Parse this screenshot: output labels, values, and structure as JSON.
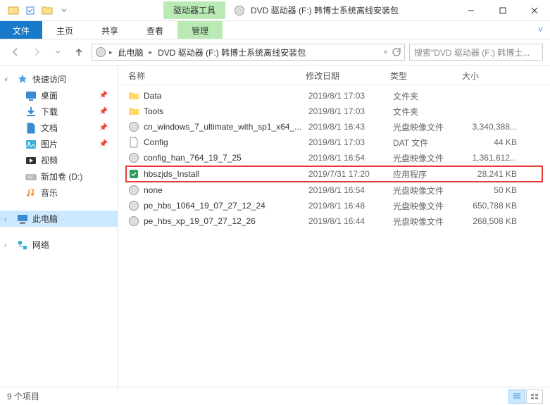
{
  "title_bar": {
    "tool_tab": "驱动器工具",
    "window_title": "DVD 驱动器 (F:) 韩博士系统离线安装包"
  },
  "ribbon": {
    "file": "文件",
    "home": "主页",
    "share": "共享",
    "view": "查看",
    "manage": "管理"
  },
  "address": {
    "crumb_pc": "此电脑",
    "crumb_drive": "DVD 驱动器 (F:) 韩博士系统离线安装包",
    "search_placeholder": "搜索\"DVD 驱动器 (F:) 韩博士..."
  },
  "sidebar": {
    "quick": "快速访问",
    "desktop": "桌面",
    "downloads": "下载",
    "documents": "文档",
    "pictures": "图片",
    "videos": "视频",
    "newvol": "新加卷 (D:)",
    "music": "音乐",
    "thispc": "此电脑",
    "network": "网络"
  },
  "columns": {
    "name": "名称",
    "date": "修改日期",
    "type": "类型",
    "size": "大小"
  },
  "files": [
    {
      "icon": "folder",
      "name": "Data",
      "date": "2019/8/1 17:03",
      "type": "文件夹",
      "size": ""
    },
    {
      "icon": "folder",
      "name": "Tools",
      "date": "2019/8/1 17:03",
      "type": "文件夹",
      "size": ""
    },
    {
      "icon": "disc",
      "name": "cn_windows_7_ultimate_with_sp1_x64_...",
      "date": "2019/8/1 16:43",
      "type": "光盘映像文件",
      "size": "3,340,388..."
    },
    {
      "icon": "file",
      "name": "Config",
      "date": "2019/8/1 17:03",
      "type": "DAT 文件",
      "size": "44 KB"
    },
    {
      "icon": "disc",
      "name": "config_han_764_19_7_25",
      "date": "2019/8/1 16:54",
      "type": "光盘映像文件",
      "size": "1,361,612..."
    },
    {
      "icon": "app",
      "name": "hbszjds_Install",
      "date": "2019/7/31 17:20",
      "type": "应用程序",
      "size": "28,241 KB"
    },
    {
      "icon": "disc",
      "name": "none",
      "date": "2019/8/1 16:54",
      "type": "光盘映像文件",
      "size": "50 KB"
    },
    {
      "icon": "disc",
      "name": "pe_hbs_1064_19_07_27_12_24",
      "date": "2019/8/1 16:48",
      "type": "光盘映像文件",
      "size": "650,788 KB"
    },
    {
      "icon": "disc",
      "name": "pe_hbs_xp_19_07_27_12_26",
      "date": "2019/8/1 16:44",
      "type": "光盘映像文件",
      "size": "268,508 KB"
    }
  ],
  "status": {
    "count": "9 个项目"
  }
}
